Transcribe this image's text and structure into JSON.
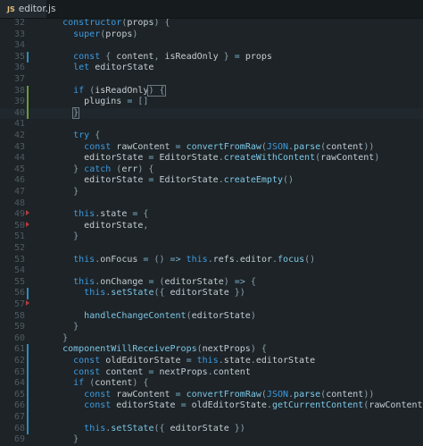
{
  "tab": {
    "icon": "JS",
    "label": "editor.js",
    "icon_name": "javascript-file-icon"
  },
  "colors": {
    "background": "#1d2327",
    "keyword": "#3d9be0",
    "function": "#7cc7e6",
    "text": "#c5ced4",
    "line_number": "#4f5b62",
    "git_modified": "#2e8bbd",
    "git_added": "#6a9a3a",
    "git_deleted": "#b5393c"
  },
  "lines": [
    {
      "num": "32",
      "git": "",
      "tokens": [
        [
          "pl",
          "    "
        ],
        [
          "kw",
          "constructor"
        ],
        [
          "br",
          "("
        ],
        [
          "pl",
          "props"
        ],
        [
          "br",
          ") {"
        ]
      ]
    },
    {
      "num": "33",
      "git": "",
      "tokens": [
        [
          "pl",
          "      "
        ],
        [
          "kw",
          "super"
        ],
        [
          "br",
          "("
        ],
        [
          "pl",
          "props"
        ],
        [
          "br",
          ")"
        ]
      ]
    },
    {
      "num": "34",
      "git": "",
      "tokens": []
    },
    {
      "num": "35",
      "git": "mod",
      "tokens": [
        [
          "pl",
          "      "
        ],
        [
          "kw",
          "const"
        ],
        [
          "br",
          " { "
        ],
        [
          "pl",
          "content"
        ],
        [
          "br",
          ", "
        ],
        [
          "pl",
          "isReadOnly"
        ],
        [
          "br",
          " } "
        ],
        [
          "op",
          "="
        ],
        [
          "pl",
          " props"
        ]
      ]
    },
    {
      "num": "36",
      "git": "",
      "tokens": [
        [
          "pl",
          "      "
        ],
        [
          "kw",
          "let"
        ],
        [
          "pl",
          " editorState"
        ]
      ]
    },
    {
      "num": "37",
      "git": "",
      "tokens": []
    },
    {
      "num": "38",
      "git": "add",
      "tokens": [
        [
          "pl",
          "      "
        ],
        [
          "kw",
          "if"
        ],
        [
          "br",
          " ("
        ],
        [
          "pl",
          "isReadOnly"
        ],
        [
          "br",
          ") {"
        ]
      ]
    },
    {
      "num": "39",
      "git": "add",
      "tokens": [
        [
          "pl",
          "        plugins "
        ],
        [
          "op",
          "="
        ],
        [
          "br",
          " []"
        ]
      ]
    },
    {
      "num": "40",
      "git": "add",
      "tokens": [
        [
          "pl",
          "      "
        ],
        [
          "br",
          "}"
        ]
      ]
    },
    {
      "num": "41",
      "git": "",
      "tokens": []
    },
    {
      "num": "42",
      "git": "",
      "tokens": [
        [
          "pl",
          "      "
        ],
        [
          "kw",
          "try"
        ],
        [
          "br",
          " {"
        ]
      ]
    },
    {
      "num": "43",
      "git": "",
      "tokens": [
        [
          "pl",
          "        "
        ],
        [
          "kw",
          "const"
        ],
        [
          "pl",
          " rawContent "
        ],
        [
          "op",
          "="
        ],
        [
          "pl",
          " "
        ],
        [
          "fn",
          "convertFromRaw"
        ],
        [
          "br",
          "("
        ],
        [
          "kw",
          "JSON"
        ],
        [
          "br",
          "."
        ],
        [
          "fn",
          "parse"
        ],
        [
          "br",
          "("
        ],
        [
          "pl",
          "content"
        ],
        [
          "br",
          "))"
        ]
      ]
    },
    {
      "num": "44",
      "git": "",
      "tokens": [
        [
          "pl",
          "        editorState "
        ],
        [
          "op",
          "="
        ],
        [
          "pl",
          " EditorState"
        ],
        [
          "br",
          "."
        ],
        [
          "fn",
          "createWithContent"
        ],
        [
          "br",
          "("
        ],
        [
          "pl",
          "rawContent"
        ],
        [
          "br",
          ")"
        ]
      ]
    },
    {
      "num": "45",
      "git": "",
      "tokens": [
        [
          "pl",
          "      "
        ],
        [
          "br",
          "} "
        ],
        [
          "kw",
          "catch"
        ],
        [
          "br",
          " ("
        ],
        [
          "pl",
          "err"
        ],
        [
          "br",
          ") {"
        ]
      ]
    },
    {
      "num": "46",
      "git": "",
      "tokens": [
        [
          "pl",
          "        editorState "
        ],
        [
          "op",
          "="
        ],
        [
          "pl",
          " EditorState"
        ],
        [
          "br",
          "."
        ],
        [
          "fn",
          "createEmpty"
        ],
        [
          "br",
          "()"
        ]
      ]
    },
    {
      "num": "47",
      "git": "",
      "tokens": [
        [
          "pl",
          "      "
        ],
        [
          "br",
          "}"
        ]
      ]
    },
    {
      "num": "48",
      "git": "",
      "tokens": []
    },
    {
      "num": "49",
      "git": "del",
      "tokens": [
        [
          "pl",
          "      "
        ],
        [
          "kw",
          "this"
        ],
        [
          "br",
          "."
        ],
        [
          "pl",
          "state "
        ],
        [
          "op",
          "="
        ],
        [
          "br",
          " {"
        ]
      ]
    },
    {
      "num": "50",
      "git": "del",
      "tokens": [
        [
          "pl",
          "        editorState"
        ],
        [
          "br",
          ","
        ]
      ]
    },
    {
      "num": "51",
      "git": "",
      "tokens": [
        [
          "pl",
          "      "
        ],
        [
          "br",
          "}"
        ]
      ]
    },
    {
      "num": "52",
      "git": "",
      "tokens": []
    },
    {
      "num": "53",
      "git": "",
      "tokens": [
        [
          "pl",
          "      "
        ],
        [
          "kw",
          "this"
        ],
        [
          "br",
          "."
        ],
        [
          "pl",
          "onFocus "
        ],
        [
          "op",
          "="
        ],
        [
          "br",
          " () "
        ],
        [
          "op",
          "=>"
        ],
        [
          "pl",
          " "
        ],
        [
          "kw",
          "this"
        ],
        [
          "br",
          "."
        ],
        [
          "pl",
          "refs"
        ],
        [
          "br",
          "."
        ],
        [
          "pl",
          "editor"
        ],
        [
          "br",
          "."
        ],
        [
          "fn",
          "focus"
        ],
        [
          "br",
          "()"
        ]
      ]
    },
    {
      "num": "54",
      "git": "",
      "tokens": []
    },
    {
      "num": "55",
      "git": "",
      "tokens": [
        [
          "pl",
          "      "
        ],
        [
          "kw",
          "this"
        ],
        [
          "br",
          "."
        ],
        [
          "pl",
          "onChange "
        ],
        [
          "op",
          "="
        ],
        [
          "br",
          " ("
        ],
        [
          "pl",
          "editorState"
        ],
        [
          "br",
          ") "
        ],
        [
          "op",
          "=>"
        ],
        [
          "br",
          " {"
        ]
      ]
    },
    {
      "num": "56",
      "git": "mod",
      "tokens": [
        [
          "pl",
          "        "
        ],
        [
          "kw",
          "this"
        ],
        [
          "br",
          "."
        ],
        [
          "fn",
          "setState"
        ],
        [
          "br",
          "({ "
        ],
        [
          "pl",
          "editorState"
        ],
        [
          "br",
          " })"
        ]
      ]
    },
    {
      "num": "57",
      "git": "del",
      "tokens": []
    },
    {
      "num": "58",
      "git": "",
      "tokens": [
        [
          "pl",
          "        "
        ],
        [
          "fn",
          "handleChangeContent"
        ],
        [
          "br",
          "("
        ],
        [
          "pl",
          "editorState"
        ],
        [
          "br",
          ")"
        ]
      ]
    },
    {
      "num": "59",
      "git": "",
      "tokens": [
        [
          "pl",
          "      "
        ],
        [
          "br",
          "}"
        ]
      ]
    },
    {
      "num": "60",
      "git": "",
      "tokens": [
        [
          "pl",
          "    "
        ],
        [
          "br",
          "}"
        ]
      ]
    },
    {
      "num": "61",
      "git": "mod",
      "tokens": [
        [
          "pl",
          "    "
        ],
        [
          "fn",
          "componentWillReceiveProps"
        ],
        [
          "br",
          "("
        ],
        [
          "pl",
          "nextProps"
        ],
        [
          "br",
          ") {"
        ]
      ]
    },
    {
      "num": "62",
      "git": "mod",
      "tokens": [
        [
          "pl",
          "      "
        ],
        [
          "kw",
          "const"
        ],
        [
          "pl",
          " oldEditorState "
        ],
        [
          "op",
          "="
        ],
        [
          "pl",
          " "
        ],
        [
          "kw",
          "this"
        ],
        [
          "br",
          "."
        ],
        [
          "pl",
          "state"
        ],
        [
          "br",
          "."
        ],
        [
          "pl",
          "editorState"
        ]
      ]
    },
    {
      "num": "63",
      "git": "mod",
      "tokens": [
        [
          "pl",
          "      "
        ],
        [
          "kw",
          "const"
        ],
        [
          "pl",
          " content "
        ],
        [
          "op",
          "="
        ],
        [
          "pl",
          " nextProps"
        ],
        [
          "br",
          "."
        ],
        [
          "pl",
          "content"
        ]
      ]
    },
    {
      "num": "64",
      "git": "mod",
      "tokens": [
        [
          "pl",
          "      "
        ],
        [
          "kw",
          "if"
        ],
        [
          "br",
          " ("
        ],
        [
          "pl",
          "content"
        ],
        [
          "br",
          ") {"
        ]
      ]
    },
    {
      "num": "65",
      "git": "mod",
      "tokens": [
        [
          "pl",
          "        "
        ],
        [
          "kw",
          "const"
        ],
        [
          "pl",
          " rawContent "
        ],
        [
          "op",
          "="
        ],
        [
          "pl",
          " "
        ],
        [
          "fn",
          "convertFromRaw"
        ],
        [
          "br",
          "("
        ],
        [
          "kw",
          "JSON"
        ],
        [
          "br",
          "."
        ],
        [
          "fn",
          "parse"
        ],
        [
          "br",
          "("
        ],
        [
          "pl",
          "content"
        ],
        [
          "br",
          "))"
        ]
      ]
    },
    {
      "num": "66",
      "git": "mod",
      "tokens": [
        [
          "pl",
          "        "
        ],
        [
          "kw",
          "const"
        ],
        [
          "pl",
          " editorState "
        ],
        [
          "op",
          "="
        ],
        [
          "pl",
          " oldEditorState"
        ],
        [
          "br",
          "."
        ],
        [
          "fn",
          "getCurrentContent"
        ],
        [
          "br",
          "("
        ],
        [
          "pl",
          "rawContent"
        ],
        [
          "br",
          ")"
        ]
      ]
    },
    {
      "num": "67",
      "git": "mod",
      "tokens": []
    },
    {
      "num": "68",
      "git": "mod",
      "tokens": [
        [
          "pl",
          "        "
        ],
        [
          "kw",
          "this"
        ],
        [
          "br",
          "."
        ],
        [
          "fn",
          "setState"
        ],
        [
          "br",
          "({ "
        ],
        [
          "pl",
          "editorState"
        ],
        [
          "br",
          " })"
        ]
      ]
    },
    {
      "num": "69",
      "git": "",
      "tokens": [
        [
          "pl",
          "      "
        ],
        [
          "br",
          "}"
        ]
      ]
    }
  ]
}
